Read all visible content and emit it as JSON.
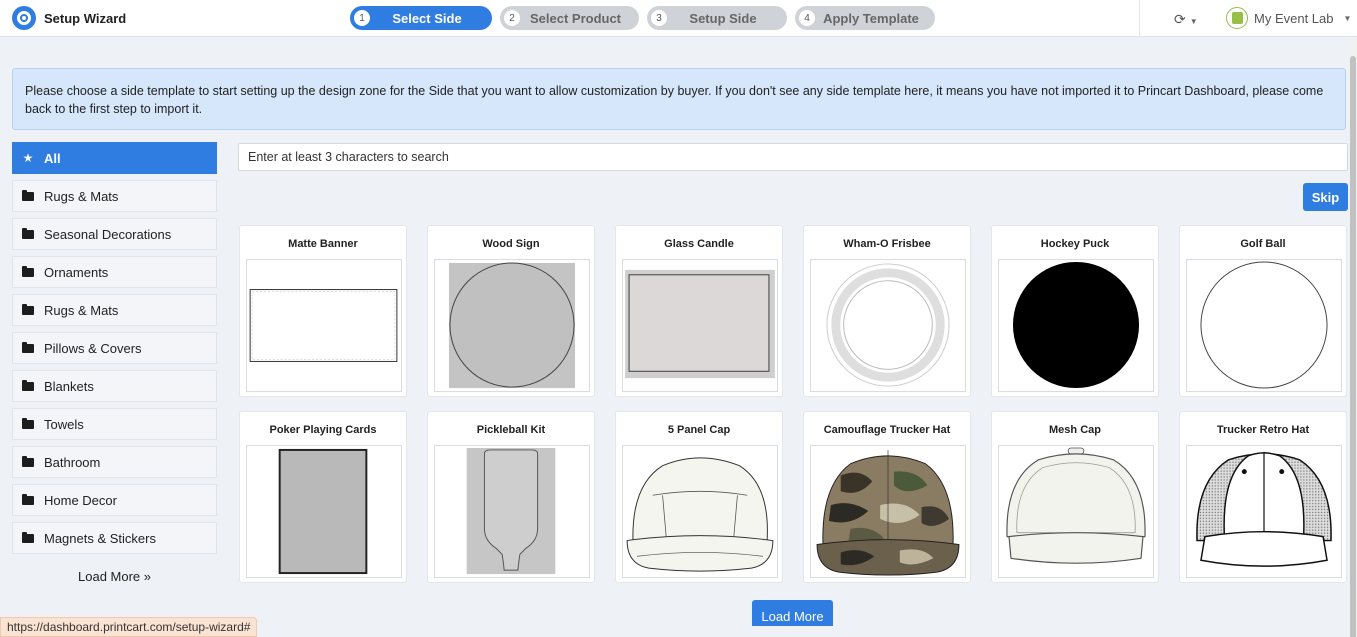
{
  "header": {
    "title": "Setup Wizard",
    "steps": [
      {
        "num": "1",
        "label": "Select Side",
        "active": true
      },
      {
        "num": "2",
        "label": "Select Product",
        "active": false
      },
      {
        "num": "3",
        "label": "Setup Side",
        "active": false
      },
      {
        "num": "4",
        "label": "Apply Template",
        "active": false
      }
    ],
    "store_name": "My Event Lab",
    "icons": {
      "sync": "sync-icon",
      "store": "shopify-icon",
      "brand": "printcart-logo-icon"
    }
  },
  "notice": "Please choose a side template to start setting up the design zone for the Side that you want to allow customization by buyer. If you don't see any side template here, it means you have not imported it to Princart Dashboard, please come back to the first step to import it.",
  "sidebar": {
    "items": [
      {
        "label": "All",
        "icon": "star-icon",
        "active": true
      },
      {
        "label": "Rugs & Mats",
        "icon": "folder-icon"
      },
      {
        "label": "Seasonal Decorations",
        "icon": "folder-icon"
      },
      {
        "label": "Ornaments",
        "icon": "folder-icon"
      },
      {
        "label": "Rugs & Mats",
        "icon": "folder-icon"
      },
      {
        "label": "Pillows & Covers",
        "icon": "folder-icon"
      },
      {
        "label": "Blankets",
        "icon": "folder-icon"
      },
      {
        "label": "Towels",
        "icon": "folder-icon"
      },
      {
        "label": "Bathroom",
        "icon": "folder-icon"
      },
      {
        "label": "Home Decor",
        "icon": "folder-icon"
      },
      {
        "label": "Magnets & Stickers",
        "icon": "folder-icon"
      }
    ],
    "load_more": "Load More »"
  },
  "search": {
    "placeholder": "Enter at least 3 characters to search"
  },
  "skip_label": "Skip",
  "templates": [
    {
      "title": "Matte Banner"
    },
    {
      "title": "Wood Sign"
    },
    {
      "title": "Glass Candle"
    },
    {
      "title": "Wham-O Frisbee"
    },
    {
      "title": "Hockey Puck"
    },
    {
      "title": "Golf Ball"
    },
    {
      "title": "Poker Playing Cards"
    },
    {
      "title": "Pickleball Kit"
    },
    {
      "title": "5 Panel Cap"
    },
    {
      "title": "Camouflage Trucker Hat"
    },
    {
      "title": "Mesh Cap"
    },
    {
      "title": "Trucker Retro Hat"
    }
  ],
  "load_more_label": "Load More",
  "status_url": "https://dashboard.printcart.com/setup-wizard#",
  "colors": {
    "accent": "#2f7de0",
    "notice_bg": "#d6e6fb"
  }
}
